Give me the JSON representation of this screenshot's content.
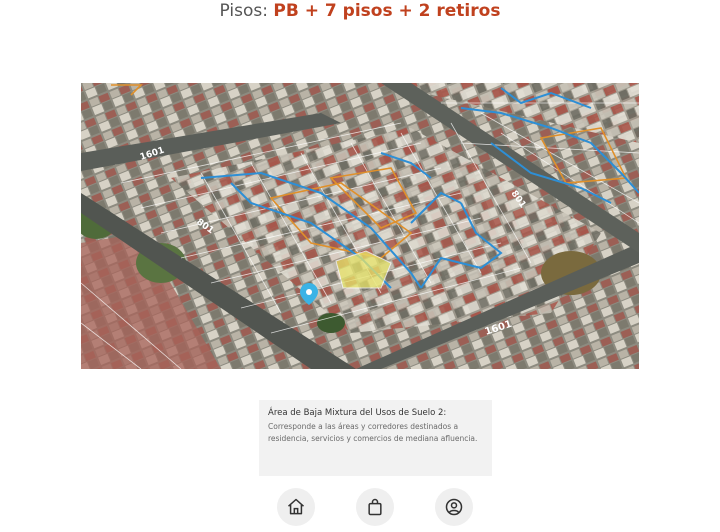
{
  "header": {
    "floors_label": "Pisos: ",
    "floors_value": "PB + 7 pisos + 2 retiros"
  },
  "map": {
    "street_labels": [
      "1601",
      "801",
      "801",
      "1601"
    ],
    "pin_icon": "map-pin-icon"
  },
  "info": {
    "title": "Área de Baja Mixtura del Usos de Suelo 2:",
    "description": "Corresponde a las áreas y corredores destinados a residencia, servicios y comercios de mediana afluencia."
  },
  "nav": {
    "items": [
      {
        "icon": "home-icon"
      },
      {
        "icon": "shopping-bag-icon"
      },
      {
        "icon": "user-circle-icon"
      }
    ]
  },
  "colors": {
    "accent": "#c0411e",
    "blue_boundary": "#2d8fd6",
    "orange_boundary": "#e0902a",
    "selected_lot": "#e8e56a"
  }
}
